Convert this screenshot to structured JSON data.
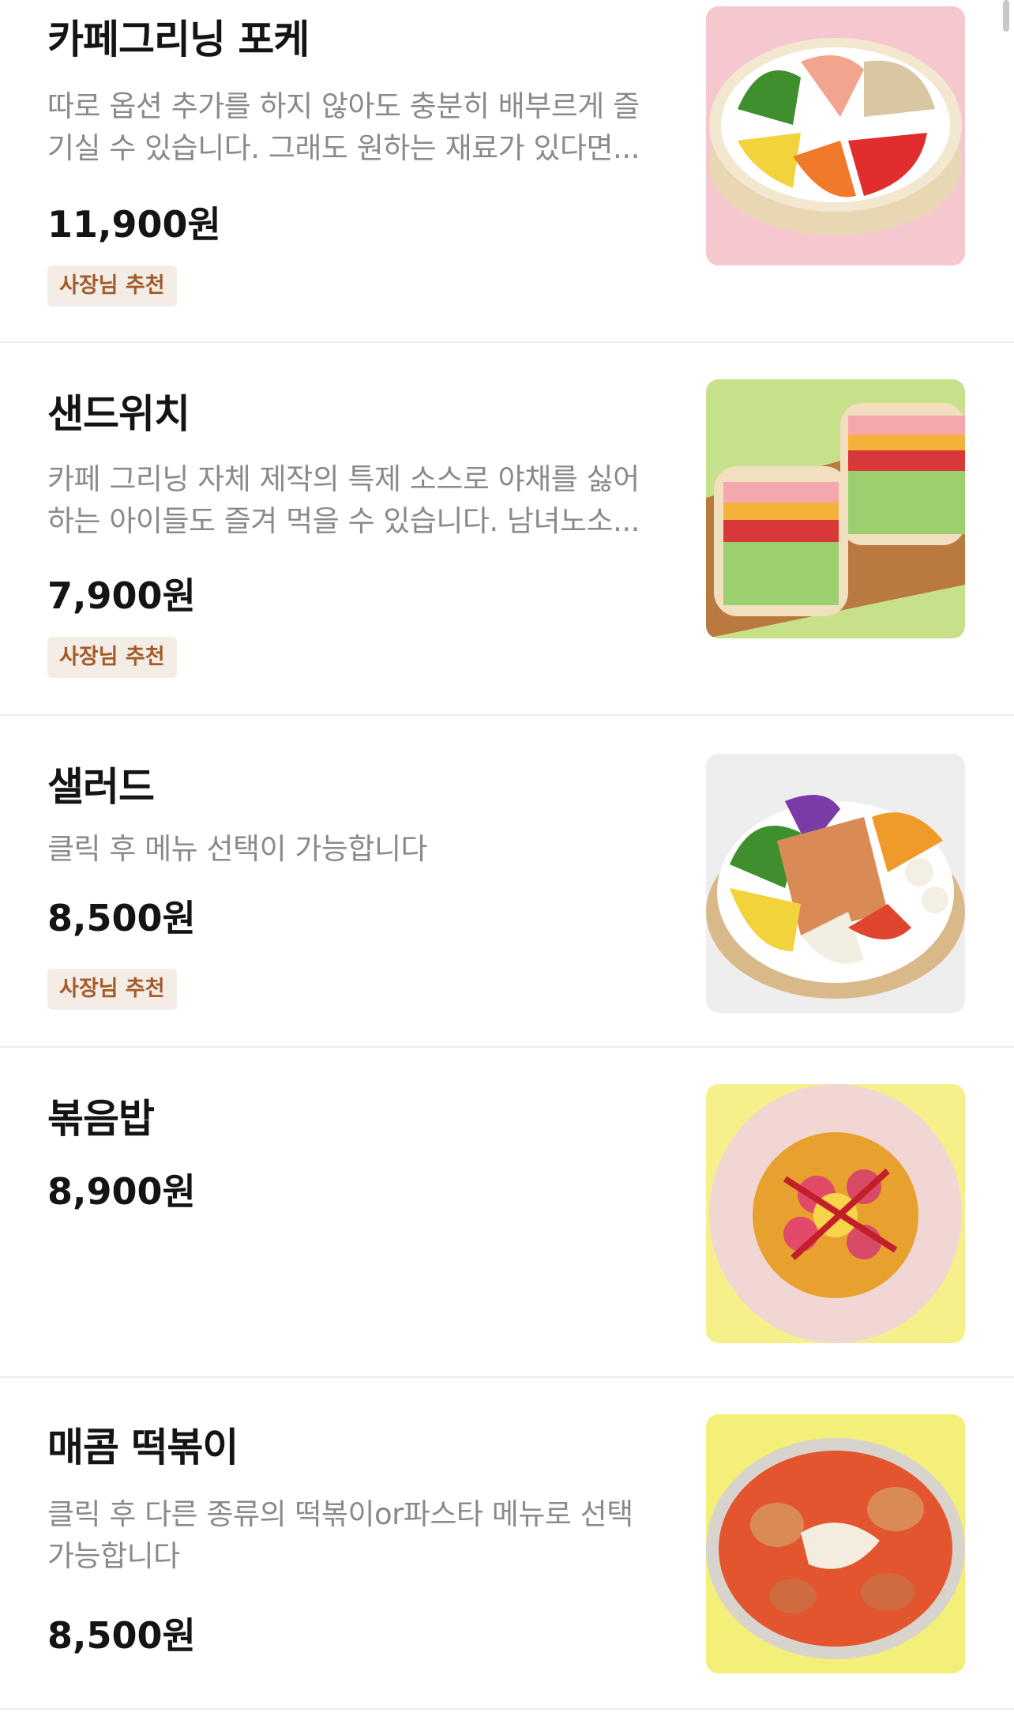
{
  "menu": {
    "items": [
      {
        "name": "카페그리닝 포케",
        "desc_lines": [
          "따로 옵션 추가를 하지 않아도 충분히 배부르게 즐",
          "기실 수 있습니다.  그래도 원하는 재료가 있다면..."
        ],
        "price": "11,900원",
        "badge": "사장님 추천",
        "image_icon": "poke-bowl-image",
        "image_bg": "#f5c7cf"
      },
      {
        "name": "샌드위치",
        "desc_lines": [
          "카페 그리닝 자체 제작의 특제 소스로 야채를 싫어",
          "하는 아이들도 즐겨 먹을 수 있습니다. 남녀노소..."
        ],
        "price": "7,900원",
        "badge": "사장님 추천",
        "image_icon": "sandwich-image",
        "image_bg": "#c7e08a"
      },
      {
        "name": "샐러드",
        "desc_lines": [
          "클릭 후 메뉴 선택이 가능합니다"
        ],
        "price": "8,500원",
        "badge": "사장님 추천",
        "image_icon": "salad-bowl-image",
        "image_bg": "#eeeeee"
      },
      {
        "name": "볶음밥",
        "desc_lines": [],
        "price": "8,900원",
        "badge": "",
        "image_icon": "fried-rice-image",
        "image_bg": "#f6f08a"
      },
      {
        "name": "매콤  떡볶이",
        "desc_lines": [
          "클릭 후 다른 종류의 떡볶이or파스타 메뉴로 선택",
          "가능합니다"
        ],
        "price": "8,500원",
        "badge": "",
        "image_icon": "tteokbokki-image",
        "image_bg": "#f4ef78"
      }
    ]
  }
}
